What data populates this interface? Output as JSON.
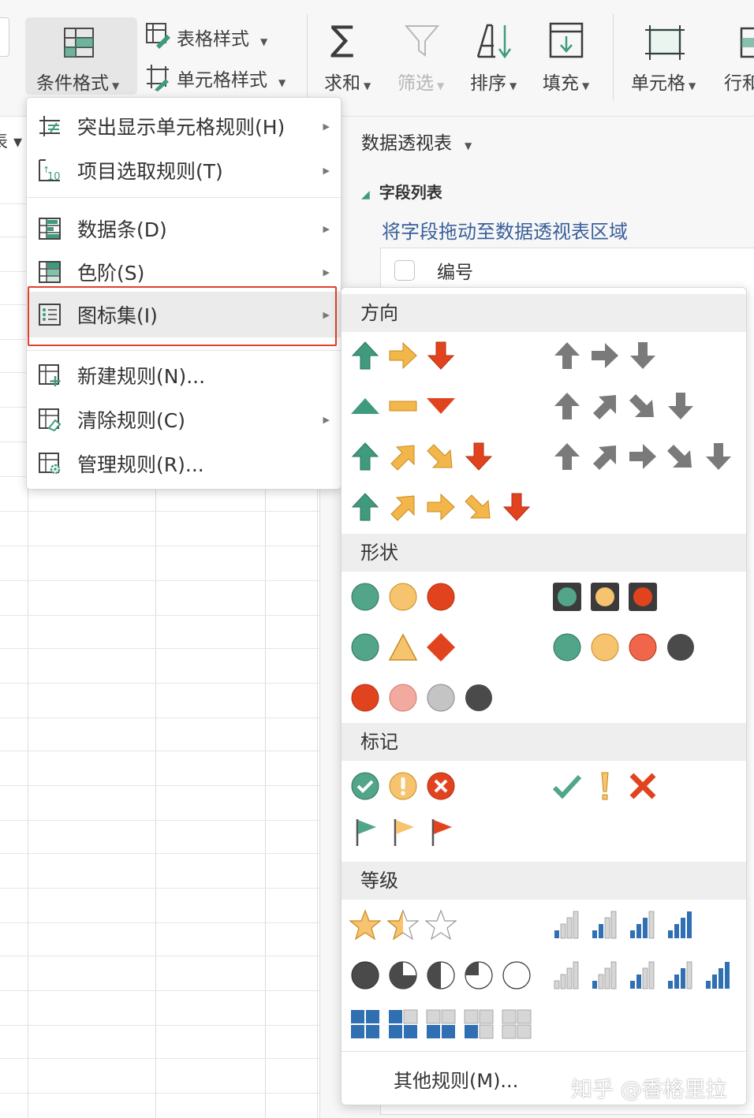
{
  "ribbon": {
    "conditional_format": "条件格式",
    "table_style": "表格样式",
    "cell_style": "单元格样式",
    "sum": "求和",
    "filter": "筛选",
    "sort": "排序",
    "fill": "填充",
    "cell": "单元格",
    "row_col": "行和"
  },
  "sheet": {
    "left_tab_label": "表"
  },
  "panel": {
    "title": "数据透视表",
    "field_list": "字段列表",
    "drag_hint": "将字段拖动至数据透视表区域",
    "field_1": "编号"
  },
  "menu": {
    "items": [
      {
        "label": "突出显示单元格规则(H)",
        "icon": "highlight-rules-icon",
        "has_submenu": true
      },
      {
        "label": "项目选取规则(T)",
        "icon": "top-bottom-rules-icon",
        "has_submenu": true
      },
      {
        "label": "数据条(D)",
        "icon": "data-bars-icon",
        "has_submenu": true
      },
      {
        "label": "色阶(S)",
        "icon": "color-scales-icon",
        "has_submenu": true
      },
      {
        "label": "图标集(I)",
        "icon": "icon-sets-icon",
        "has_submenu": true,
        "selected": true
      },
      {
        "label": "新建规则(N)...",
        "icon": "new-rule-icon",
        "has_submenu": false
      },
      {
        "label": "清除规则(C)",
        "icon": "clear-rules-icon",
        "has_submenu": true
      },
      {
        "label": "管理规则(R)...",
        "icon": "manage-rules-icon",
        "has_submenu": false
      }
    ]
  },
  "submenu": {
    "sections": {
      "direction": "方向",
      "shapes": "形状",
      "indicators": "标记",
      "ratings": "等级"
    },
    "more_rules": "其他规则(M)..."
  },
  "watermark": "知乎 @香格里拉",
  "colors": {
    "green": "#3f9a7e",
    "amber": "#f2b64a",
    "red": "#e2431f",
    "gray": "#7a7a7a",
    "blue": "#2f6fb2",
    "highlight_border": "#e0412b"
  }
}
